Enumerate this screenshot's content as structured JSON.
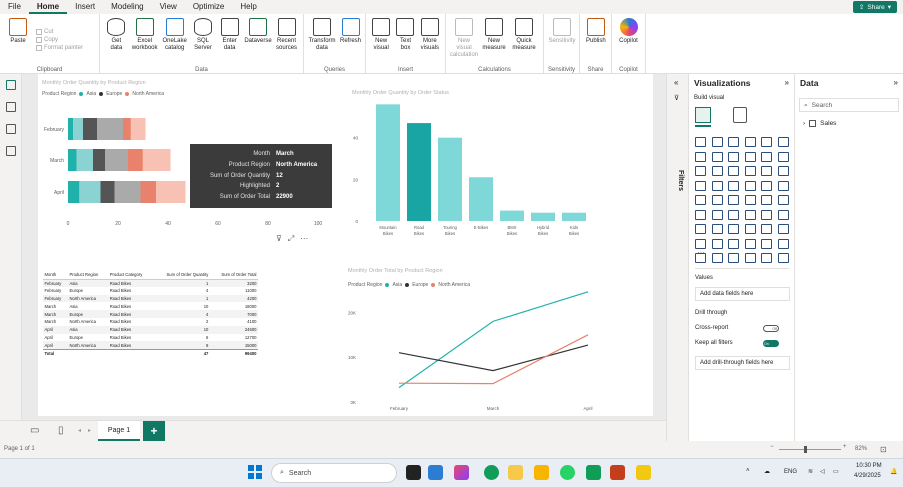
{
  "tabs": [
    "File",
    "Home",
    "Insert",
    "Modeling",
    "View",
    "Optimize",
    "Help"
  ],
  "active_tab": "Home",
  "share_label": "Share",
  "ribbon": {
    "clipboard": {
      "paste": "Paste",
      "cut": "Cut",
      "copy": "Copy",
      "format_painter": "Format painter",
      "label": "Clipboard"
    },
    "data": {
      "label": "Data",
      "buttons": [
        "Get data",
        "Excel workbook",
        "OneLake catalog",
        "SQL Server",
        "Enter data",
        "Dataverse",
        "Recent sources"
      ]
    },
    "queries": {
      "label": "Queries",
      "buttons": [
        "Transform data",
        "Refresh"
      ]
    },
    "insert": {
      "label": "Insert",
      "buttons": [
        "New visual",
        "Text box",
        "More visuals"
      ]
    },
    "calculations": {
      "label": "Calculations",
      "buttons": [
        "New visual calculation",
        "New measure",
        "Quick measure"
      ]
    },
    "sensitivity": {
      "label": "Sensitivity",
      "buttons": [
        "Sensitivity"
      ]
    },
    "share": {
      "label": "Share",
      "buttons": [
        "Publish"
      ]
    },
    "copilot": {
      "label": "Copilot",
      "buttons": [
        "Copilot"
      ]
    }
  },
  "canvas": {
    "visual1": {
      "title": "Monthly Order Quantity by Product Region",
      "legend_title": "Product Region",
      "legend": [
        "Asia",
        "Europe",
        "North America"
      ]
    },
    "visual2": {
      "title": "Monthly Order Quantity by Order Status"
    },
    "visual4": {
      "title": "Monthly Order Total by Product Region",
      "legend_title": "Product Region",
      "legend": [
        "Asia",
        "Europe",
        "North America"
      ]
    },
    "tooltip": [
      {
        "k": "Month",
        "v": "March"
      },
      {
        "k": "Product Region",
        "v": "North America"
      },
      {
        "k": "Sum of Order Quantity",
        "v": "12"
      },
      {
        "k": "Highlighted",
        "v": "2"
      },
      {
        "k": "Sum of Order Total",
        "v": "22900"
      }
    ],
    "table": {
      "headers": [
        "Month",
        "Product Region",
        "Product Category",
        "Sum of Order Quantity",
        "Sum of Order Total"
      ],
      "rows": [
        [
          "February",
          "Asia",
          "Road Bikes",
          "1",
          "3200"
        ],
        [
          "February",
          "Europe",
          "Road Bikes",
          "4",
          "11000"
        ],
        [
          "February",
          "North America",
          "Road Bikes",
          "1",
          "4200"
        ],
        [
          "March",
          "Asia",
          "Road Bikes",
          "10",
          "18000"
        ],
        [
          "March",
          "Europe",
          "Road Bikes",
          "4",
          "7000"
        ],
        [
          "March",
          "North America",
          "Road Bikes",
          "2",
          "4100"
        ],
        [
          "April",
          "Asia",
          "Road Bikes",
          "10",
          "24600"
        ],
        [
          "April",
          "Europe",
          "Road Bikes",
          "6",
          "12700"
        ],
        [
          "April",
          "North America",
          "Road Bikes",
          "9",
          "15000"
        ]
      ],
      "total": [
        "Total",
        "",
        "",
        "47",
        "99400"
      ]
    }
  },
  "chart_data": [
    {
      "type": "bar",
      "orientation": "horizontal",
      "stacked": true,
      "categories": [
        "February",
        "March",
        "April"
      ],
      "series": [
        {
          "name": "Asia",
          "values": [
            6,
            10,
            13
          ]
        },
        {
          "name": "Europe",
          "values": [
            16,
            14,
            16
          ]
        },
        {
          "name": "North America",
          "values": [
            9,
            17,
            18
          ]
        }
      ],
      "xlim": [
        0,
        100
      ],
      "xticks": [
        "0",
        "20",
        "40",
        "60",
        "80",
        "100"
      ],
      "colors": [
        "#118dff",
        "#12239e",
        "#e66c37"
      ]
    },
    {
      "type": "bar",
      "categories": [
        "Mountain Bikes",
        "Road Bikes",
        "Touring Bikes",
        "E-Bikes",
        "BMX Bikes",
        "Hybrid Bikes",
        "Kids Bikes"
      ],
      "values": [
        56,
        47,
        40,
        21,
        5,
        4,
        4
      ],
      "ylim": [
        0,
        60
      ],
      "yticks": [
        "0",
        "20",
        "40"
      ]
    },
    {
      "type": "line",
      "x": [
        "February",
        "March",
        "April"
      ],
      "series": [
        {
          "name": "Asia",
          "values": [
            3200,
            18000,
            24600
          ]
        },
        {
          "name": "Europe",
          "values": [
            11000,
            7000,
            12700
          ]
        },
        {
          "name": "North America",
          "values": [
            4200,
            4100,
            15000
          ]
        }
      ],
      "ylim": [
        0,
        25000
      ],
      "yticks": [
        "0K",
        "10K",
        "20K"
      ]
    }
  ],
  "colors": {
    "asia": "#20b2aa",
    "europe": "#333333",
    "north_america": "#e8826c",
    "bar": "#7fd8d8",
    "accent": "#117865"
  },
  "page_tab": "Page 1",
  "status": {
    "page": "Page 1 of 1",
    "zoom": "82%"
  },
  "viz_pane": {
    "title": "Visualizations",
    "build": "Build visual",
    "values_label": "Values",
    "values_placeholder": "Add data fields here",
    "drill_label": "Drill through",
    "cross_report": "Cross-report",
    "cross_report_state": "Off",
    "keep_filters": "Keep all filters",
    "keep_filters_state": "On",
    "drill_placeholder": "Add drill-through fields here"
  },
  "filters_label": "Filters",
  "data_pane": {
    "title": "Data",
    "search_placeholder": "Search",
    "tables": [
      "Sales"
    ]
  },
  "taskbar": {
    "search": "Search",
    "lang": "ENG",
    "time": "10:30 PM",
    "date": "4/29/2025"
  }
}
